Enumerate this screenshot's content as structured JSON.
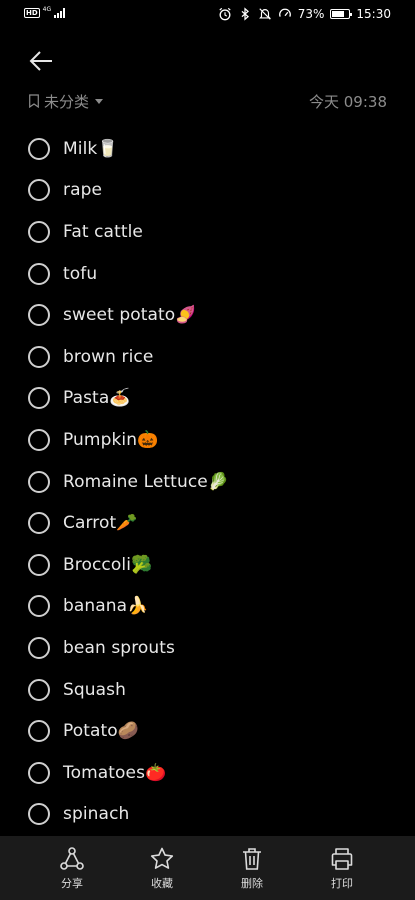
{
  "status_bar": {
    "network_badge": "HD",
    "network_type": "4G",
    "battery_percent": "73%",
    "battery_level": 0.73,
    "time": "15:30",
    "icons": [
      "alarm-icon",
      "bluetooth-icon",
      "mute-icon",
      "data-saver-icon"
    ]
  },
  "header": {
    "back_icon": "arrow-left-icon",
    "category_label": "未分类",
    "timestamp": "今天 09:38"
  },
  "checklist": {
    "items": [
      {
        "text": "Milk🥛",
        "checked": false
      },
      {
        "text": "rape",
        "checked": false
      },
      {
        "text": "Fat cattle",
        "checked": false
      },
      {
        "text": "tofu",
        "checked": false
      },
      {
        "text": "sweet potato🍠",
        "checked": false
      },
      {
        "text": "brown rice",
        "checked": false
      },
      {
        "text": "Pasta🍝",
        "checked": false
      },
      {
        "text": "Pumpkin🎃",
        "checked": false
      },
      {
        "text": "Romaine Lettuce🥬",
        "checked": false
      },
      {
        "text": "Carrot🥕",
        "checked": false
      },
      {
        "text": "Broccoli🥦",
        "checked": false
      },
      {
        "text": "banana🍌",
        "checked": false
      },
      {
        "text": "bean sprouts",
        "checked": false
      },
      {
        "text": "Squash",
        "checked": false
      },
      {
        "text": "Potato🥔",
        "checked": false
      },
      {
        "text": "Tomatoes🍅",
        "checked": false
      },
      {
        "text": "spinach",
        "checked": false
      }
    ]
  },
  "toolbar": {
    "share_label": "分享",
    "favorite_label": "收藏",
    "delete_label": "删除",
    "print_label": "打印"
  },
  "colors": {
    "background": "#000000",
    "toolbar_bg": "#1b1b1b",
    "muted_text": "#8c8c8c"
  }
}
